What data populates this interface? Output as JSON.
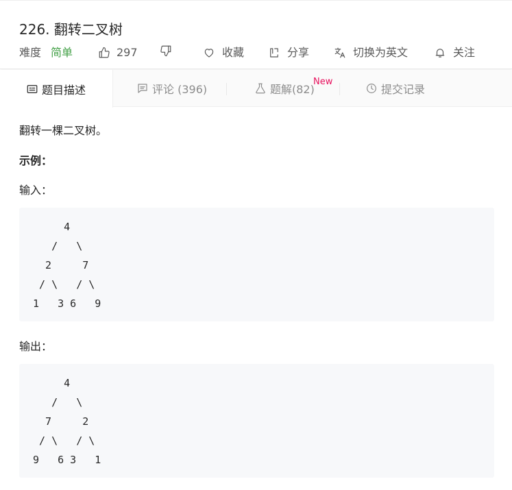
{
  "problem": {
    "title": "226. 翻转二叉树",
    "difficulty_label": "难度",
    "difficulty_value": "简单",
    "likes": "297",
    "favorite_label": "收藏",
    "share_label": "分享",
    "switch_lang_label": "切换为英文",
    "follow_label": "关注"
  },
  "tabs": {
    "description": "题目描述",
    "comments": "评论 (396)",
    "solutions": "题解(82)",
    "solutions_badge": "New",
    "submissions": "提交记录"
  },
  "body": {
    "intro": "翻转一棵二叉树。",
    "example_heading": "示例：",
    "input_label": "输入：",
    "input_code": "     4\n   /   \\\n  2     7\n / \\   / \\\n1   3 6   9",
    "output_label": "输出：",
    "output_code": "     4\n   /   \\\n  7     2\n / \\   / \\\n9   6 3   1"
  },
  "colors": {
    "easy_green": "#43a047",
    "new_badge": "#e8105d",
    "code_bg": "#f7f8fa"
  },
  "icons": [
    "thumbs-up-icon",
    "thumbs-down-icon",
    "heart-icon",
    "share-icon",
    "translate-icon",
    "bell-icon",
    "description-icon",
    "comment-icon",
    "flask-icon",
    "clock-icon"
  ]
}
